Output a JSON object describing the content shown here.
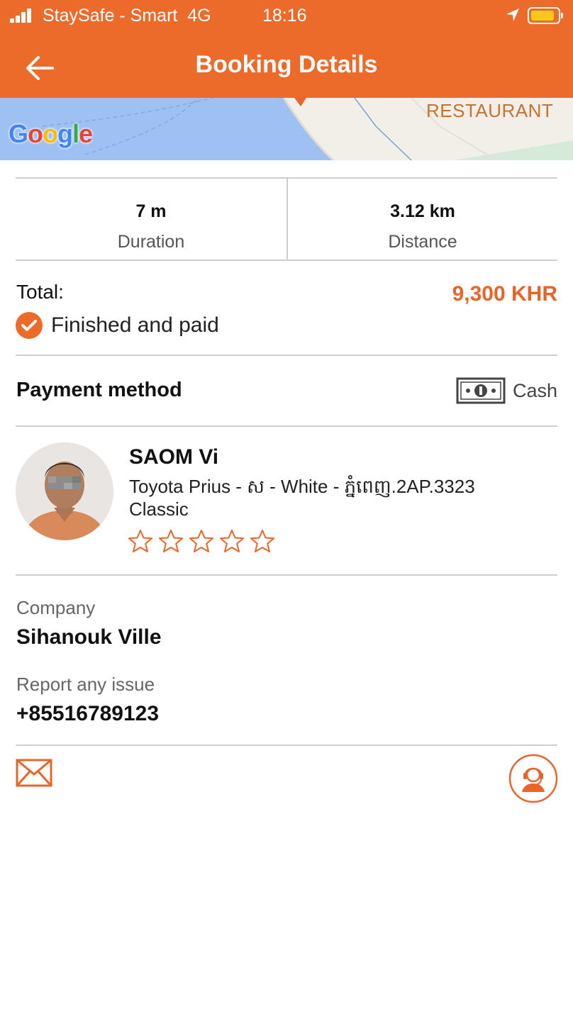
{
  "status_bar": {
    "carrier": "StaySafe - Smart",
    "network": "4G",
    "time": "18:16"
  },
  "header": {
    "title": "Booking Details",
    "back_icon": "arrow-left-icon"
  },
  "map": {
    "logo": "Google",
    "poi_label": "RESTAURANT"
  },
  "stats": {
    "duration_value": "7 m",
    "duration_label": "Duration",
    "distance_value": "3.12 km",
    "distance_label": "Distance"
  },
  "total": {
    "label": "Total:",
    "amount": "9,300 KHR",
    "status": "Finished and paid",
    "status_icon": "check-circle-icon"
  },
  "payment": {
    "label": "Payment method",
    "method": "Cash",
    "icon": "cash-icon"
  },
  "driver": {
    "name": "SAOM Vi",
    "vehicle": "Toyota Prius - ស - White - ភ្នំពេញ.2AP.3323",
    "class": "Classic",
    "rating_icon": "star-outline-icon"
  },
  "company": {
    "label": "Company",
    "value": "Sihanouk Ville"
  },
  "report": {
    "label": "Report any issue",
    "phone": "+85516789123"
  },
  "actions": {
    "mail_icon": "mail-icon",
    "support_icon": "support-agent-icon"
  },
  "colors": {
    "brand": "#ec6a2a",
    "amount": "#e8652a"
  }
}
